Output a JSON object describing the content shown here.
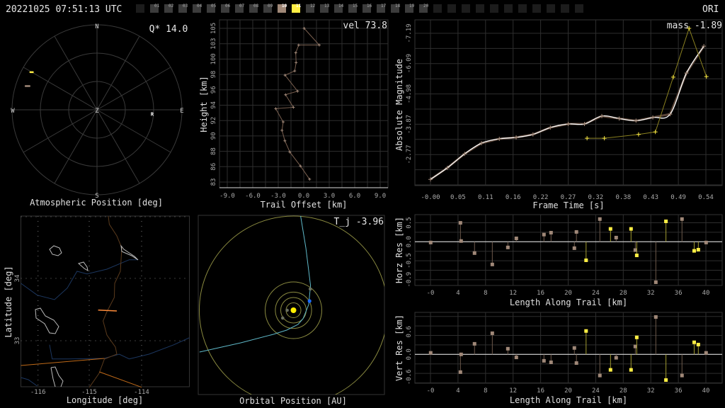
{
  "header": {
    "timestamp": "20221025 07:51:13 UTC",
    "station": "ORI",
    "frames": [
      "01",
      "02",
      "03",
      "04",
      "05",
      "06",
      "07",
      "08",
      "09",
      "10",
      "11",
      "12",
      "13",
      "14",
      "15",
      "16",
      "17",
      "18",
      "19",
      "20"
    ],
    "frame_colors": {
      "10": "#a08878",
      "11": "#ffee44"
    },
    "trailing_empty_slots": 11
  },
  "colors": {
    "camera1": "#a08878",
    "camera2": "#ffee44",
    "grid": "#2e2e2e",
    "trajectory": "#5fb8c8",
    "earth": "#1a6cff"
  },
  "atmos": {
    "title": "Atmospheric Position [deg]",
    "q_label": "Q* 14.0",
    "cardinals": {
      "N": "N",
      "S": "S",
      "E": "E",
      "W": "W",
      "Z": "Z"
    },
    "radiant": {
      "label": "R",
      "az": 94,
      "alt": 31.4
    },
    "tracks": [
      {
        "camera": "camera2",
        "az": 300,
        "alt": 10.0
      },
      {
        "camera": "camera1",
        "az": 289,
        "alt": 12.2
      }
    ]
  },
  "height": {
    "vel_label": "vel 73.8",
    "xlabel": "Trail Offset [km]",
    "ylabel": "Height [km]",
    "xticks": [
      -9,
      -6,
      -3,
      0,
      3,
      6,
      9
    ],
    "xtick_labels": [
      "-9.0",
      "-6.0",
      "-3.0",
      "0.0",
      "3.0",
      "6.0",
      "9.0"
    ],
    "yticks": [
      105,
      102.8,
      100.6,
      98.4,
      96.2,
      94,
      91.8,
      89.6,
      87.4,
      85.2,
      83
    ],
    "ytick_labels": [
      "105",
      "103",
      "100",
      "98",
      "96",
      "94",
      "92",
      "90",
      "88",
      "86",
      "83"
    ],
    "points": [
      [
        0.05,
        105.0
      ],
      [
        1.83,
        102.6
      ],
      [
        -0.6,
        102.6
      ],
      [
        -0.94,
        101.5
      ],
      [
        -0.9,
        100.1
      ],
      [
        -1.06,
        98.9
      ],
      [
        -2.2,
        98.3
      ],
      [
        -0.72,
        96.0
      ],
      [
        -2.14,
        95.5
      ],
      [
        -1.22,
        93.7
      ],
      [
        -3.3,
        93.5
      ],
      [
        -2.42,
        91.6
      ],
      [
        -2.56,
        90.4
      ],
      [
        -2.22,
        88.9
      ],
      [
        -1.64,
        87.3
      ],
      [
        -0.39,
        85.3
      ],
      [
        0.69,
        83.4
      ]
    ]
  },
  "magnitude": {
    "mass_label": "mass -1.89",
    "xlabel": "Frame Time [s]",
    "ylabel": "Absolute Magnitude",
    "xtick_labels": [
      "-0.00",
      "0.05",
      "0.11",
      "0.16",
      "0.22",
      "0.27",
      "0.32",
      "0.38",
      "0.43",
      "0.49",
      "0.54"
    ],
    "ytick_values": [
      -7.19,
      -6.09,
      -4.98,
      -3.87,
      -2.77
    ],
    "ytick_labels": [
      "-7.19",
      "-6.09",
      "-4.98",
      "-3.87",
      "-2.77"
    ],
    "camera1": [
      [
        0,
        -1.86
      ],
      [
        0.033,
        -2.28
      ],
      [
        0.067,
        -2.79
      ],
      [
        0.1,
        -3.18
      ],
      [
        0.135,
        -3.34
      ],
      [
        0.168,
        -3.39
      ],
      [
        0.201,
        -3.5
      ],
      [
        0.235,
        -3.75
      ],
      [
        0.27,
        -3.88
      ],
      [
        0.302,
        -3.88
      ],
      [
        0.336,
        -4.17
      ],
      [
        0.37,
        -4.08
      ],
      [
        0.403,
        -4.0
      ],
      [
        0.436,
        -4.12
      ],
      [
        0.47,
        -4.24
      ],
      [
        0.502,
        -5.74
      ],
      [
        0.536,
        -6.72
      ]
    ],
    "camera2": [
      [
        0.307,
        -3.36
      ],
      [
        0.341,
        -3.36
      ],
      [
        0.408,
        -3.5
      ],
      [
        0.441,
        -3.59
      ],
      [
        0.476,
        -5.59
      ],
      [
        0.507,
        -7.37
      ],
      [
        0.541,
        -5.61
      ]
    ]
  },
  "horz_res": {
    "xlabel": "Length Along Trail [km]",
    "ylabel": "Horz Res [km]",
    "xticks": [
      0,
      4,
      8,
      12,
      16,
      20,
      24,
      28,
      32,
      36,
      40
    ],
    "xtick_labels": [
      "-0",
      "4",
      "8",
      "12",
      "16",
      "20",
      "24",
      "28",
      "32",
      "36",
      "40"
    ],
    "yticks": [
      0.5,
      0,
      -0.5,
      -1.0
    ],
    "ytick_labels": [
      "0.5",
      "0.0",
      "-0.5",
      "-0.9"
    ],
    "camera1": [
      [
        0.03,
        -0.02
      ],
      [
        4.35,
        0.5
      ],
      [
        4.45,
        0.02
      ],
      [
        6.4,
        -0.3
      ],
      [
        8.98,
        -0.6
      ],
      [
        11.24,
        -0.15
      ],
      [
        12.47,
        0.09
      ],
      [
        16.48,
        0.19
      ],
      [
        17.51,
        0.24
      ],
      [
        20.9,
        -0.17
      ],
      [
        21.2,
        0.26
      ],
      [
        24.6,
        0.6
      ],
      [
        26.97,
        0.11
      ],
      [
        29.75,
        -0.22
      ],
      [
        32.73,
        -1.07
      ],
      [
        36.53,
        0.6
      ],
      [
        40.03,
        -0.02
      ]
    ],
    "camera2": [
      [
        22.6,
        -0.49
      ],
      [
        26.15,
        0.34
      ],
      [
        29.13,
        0.34
      ],
      [
        29.96,
        -0.36
      ],
      [
        34.2,
        0.54
      ],
      [
        38.3,
        -0.24
      ],
      [
        38.9,
        -0.21
      ]
    ]
  },
  "vert_res": {
    "xlabel": "Length Along Trail [km]",
    "ylabel": "Vert Res [km]",
    "xticks": [
      0,
      4,
      8,
      12,
      16,
      20,
      24,
      28,
      32,
      36,
      40
    ],
    "xtick_labels": [
      "-0",
      "4",
      "8",
      "12",
      "16",
      "20",
      "24",
      "28",
      "32",
      "36",
      "40"
    ],
    "yticks": [
      0.6,
      0,
      -0.6
    ],
    "ytick_labels": [
      "0.6",
      "0.0",
      "-0.6"
    ],
    "camera1": [
      [
        0.03,
        0.04
      ],
      [
        4.35,
        -0.47
      ],
      [
        4.45,
        0.0
      ],
      [
        6.4,
        0.28
      ],
      [
        8.98,
        0.56
      ],
      [
        11.24,
        0.15
      ],
      [
        12.47,
        -0.08
      ],
      [
        16.48,
        -0.17
      ],
      [
        17.51,
        -0.21
      ],
      [
        20.9,
        0.17
      ],
      [
        21.2,
        -0.23
      ],
      [
        24.6,
        -0.56
      ],
      [
        26.97,
        -0.09
      ],
      [
        29.75,
        0.21
      ],
      [
        32.73,
        0.99
      ],
      [
        36.53,
        -0.56
      ],
      [
        40.03,
        0.04
      ]
    ],
    "camera2": [
      [
        22.6,
        0.62
      ],
      [
        26.15,
        -0.41
      ],
      [
        29.13,
        -0.41
      ],
      [
        29.96,
        0.45
      ],
      [
        34.2,
        -0.68
      ],
      [
        38.3,
        0.32
      ],
      [
        38.9,
        0.26
      ]
    ]
  },
  "map": {
    "xlabel": "Longitude [deg]",
    "ylabel": "Latitude [deg]",
    "lon_ticks": [
      "-116",
      "-115",
      "-114"
    ],
    "lat_ticks": [
      "34",
      "33"
    ]
  },
  "orbit": {
    "tj_label": "T_j -3.96",
    "xlabel": "Orbital Position [AU]"
  }
}
